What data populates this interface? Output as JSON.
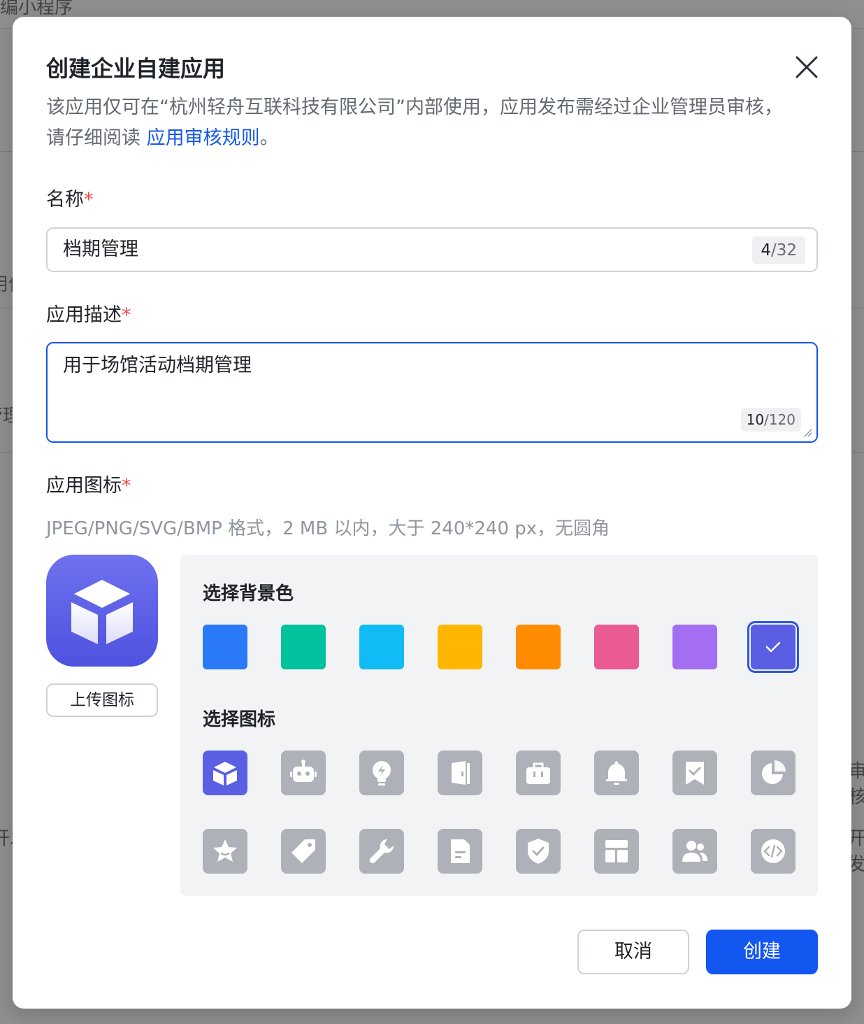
{
  "background": {
    "fragments": [
      "编小程序",
      "用信",
      "管理",
      "开发",
      "开发",
      "审核"
    ]
  },
  "dialog": {
    "title": "创建企业自建应用",
    "description_text": "该应用仅可在“杭州轻舟互联科技有限公司”内部使用，应用发布需经过企业管理员审核，请仔细阅读 ",
    "description_link": "应用审核规则",
    "description_end": "。",
    "required_mark": "*"
  },
  "name_field": {
    "label": "名称",
    "value": "档期管理",
    "count_current": "4",
    "count_max": "/32"
  },
  "desc_field": {
    "label": "应用描述",
    "value": "用于场馆活动档期管理",
    "count_current": "10",
    "count_max": "/120"
  },
  "icon_field": {
    "label": "应用图标",
    "hint": "JPEG/PNG/SVG/BMP 格式，2 MB 以内，大于 240*240 px，无圆角",
    "upload_label": "上传图标",
    "bg_heading": "选择背景色",
    "icon_heading": "选择图标",
    "colors": [
      "#2a79f7",
      "#00c39d",
      "#10bcf6",
      "#ffb600",
      "#ff8c00",
      "#ea5b95",
      "#a46ef3",
      "#5a5ee3"
    ],
    "selected_color": "#5a5ee3",
    "icons": [
      "cube-icon",
      "robot-icon",
      "lightbulb-icon",
      "door-icon",
      "briefcase-icon",
      "bell-icon",
      "bookmark-check-icon",
      "pie-chart-icon",
      "star-icon",
      "tag-icon",
      "wrench-icon",
      "document-icon",
      "shield-check-icon",
      "layout-icon",
      "users-icon",
      "code-icon"
    ],
    "selected_icon": "cube-icon",
    "tile_color": "#aeb2b8"
  },
  "footer": {
    "cancel_label": "取消",
    "create_label": "创建"
  },
  "colors": {
    "primary": "#1456f0",
    "required": "#f54a45"
  }
}
